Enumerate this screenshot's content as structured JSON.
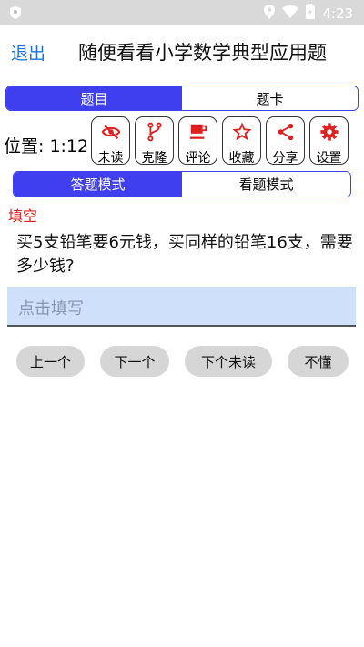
{
  "status_bar": {
    "time": "4:23"
  },
  "header": {
    "back_label": "退出",
    "title": "随便看看小学数学典型应用题"
  },
  "view_tabs": [
    {
      "label": "题目",
      "active": true
    },
    {
      "label": "题卡",
      "active": false
    }
  ],
  "position": {
    "text": "位置: 1:12"
  },
  "tools": [
    {
      "label": "未读",
      "icon": "eye-off-icon"
    },
    {
      "label": "克隆",
      "icon": "fork-icon"
    },
    {
      "label": "评论",
      "icon": "cup-icon"
    },
    {
      "label": "收藏",
      "icon": "star-icon"
    },
    {
      "label": "分享",
      "icon": "share-icon"
    },
    {
      "label": "设置",
      "icon": "gear-icon"
    }
  ],
  "mode_tabs": [
    {
      "label": "答题模式",
      "active": true
    },
    {
      "label": "看题模式",
      "active": false
    }
  ],
  "question": {
    "type": "填空",
    "text": "买5支铅笔要6元钱，买同样的铅笔16支，需要多少钱?"
  },
  "answer_input": {
    "placeholder": "点击填写",
    "value": ""
  },
  "nav_buttons": {
    "prev": "上一个",
    "next": "下一个",
    "next_unread": "下个未读",
    "dont_understand": "不懂"
  },
  "colors": {
    "accent": "#3f3ff0",
    "icon_red": "#e02020",
    "back_blue": "#1e73d9",
    "input_bg": "#cfe0fb"
  }
}
